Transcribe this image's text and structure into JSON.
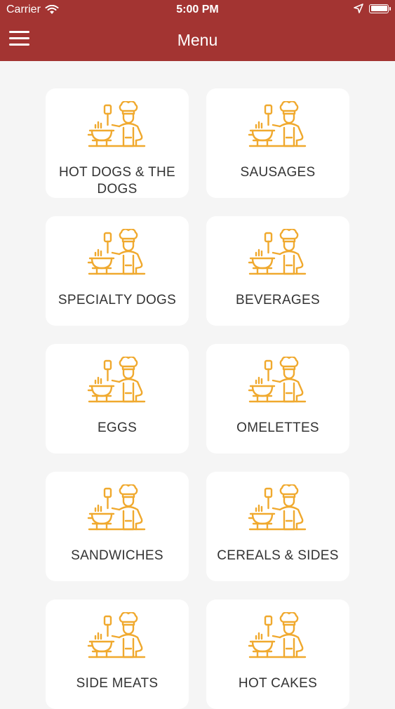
{
  "status_bar": {
    "carrier": "Carrier",
    "time": "5:00 PM",
    "icons": [
      "wifi-icon",
      "location-arrow-icon",
      "battery-icon"
    ]
  },
  "header": {
    "title": "Menu",
    "menu_icon": "hamburger-icon",
    "background_color": "#a33432"
  },
  "categories": [
    {
      "label": "HOT DOGS & THE DOGS",
      "icon": "chef-cooking-icon"
    },
    {
      "label": "SAUSAGES",
      "icon": "chef-cooking-icon"
    },
    {
      "label": "SPECIALTY DOGS",
      "icon": "chef-cooking-icon"
    },
    {
      "label": "BEVERAGES",
      "icon": "chef-cooking-icon"
    },
    {
      "label": "EGGS",
      "icon": "chef-cooking-icon"
    },
    {
      "label": "OMELETTES",
      "icon": "chef-cooking-icon"
    },
    {
      "label": "SANDWICHES",
      "icon": "chef-cooking-icon"
    },
    {
      "label": "CEREALS & SIDES",
      "icon": "chef-cooking-icon"
    },
    {
      "label": "SIDE MEATS",
      "icon": "chef-cooking-icon"
    },
    {
      "label": "HOT CAKES",
      "icon": "chef-cooking-icon"
    }
  ],
  "icon_color": "#f0a92e"
}
